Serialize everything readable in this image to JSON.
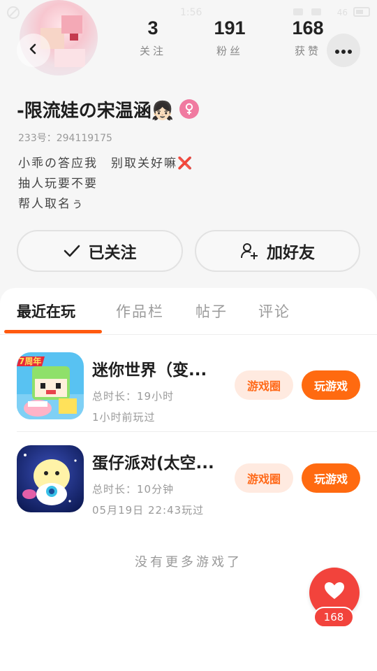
{
  "status_bar": {
    "time": "1:56",
    "battery_text": "46"
  },
  "profile": {
    "nickname": "-限流娃の宋温涵👧🏻",
    "uid": "233号：294119175",
    "bio_lines": [
      "小乖の答应我　别取关好嘛❌",
      "抽人玩要不要",
      "帮人取名ぅ"
    ]
  },
  "stats": [
    {
      "value": "3",
      "label": "关注"
    },
    {
      "value": "191",
      "label": "粉丝"
    },
    {
      "value": "168",
      "label": "获赞"
    }
  ],
  "actions": {
    "followed_label": "已关注",
    "add_friend_label": "加好友"
  },
  "tabs": [
    {
      "label": "最近在玩",
      "active": true
    },
    {
      "label": "作品栏",
      "active": false
    },
    {
      "label": "帖子",
      "active": false
    },
    {
      "label": "评论",
      "active": false
    }
  ],
  "games": [
    {
      "title": "迷你世界（变...",
      "duration": "总时长：19小时",
      "last_played": "1小时前玩过",
      "circle_label": "游戏圈",
      "play_label": "玩游戏",
      "icon": "mini-world-game-icon",
      "icon_text": "7周年"
    },
    {
      "title": "蛋仔派对(太空...",
      "duration": "总时长：10分钟",
      "last_played": "05月19日 22:43玩过",
      "circle_label": "游戏圈",
      "play_label": "玩游戏",
      "icon": "eggy-party-game-icon"
    }
  ],
  "no_more_text": "没有更多游戏了",
  "like": {
    "count": "168"
  },
  "colors": {
    "accent": "#ff6a10",
    "accent_soft": "#ffeae0",
    "tab_underline": "#ff5a0f",
    "like_red": "#f2433c",
    "gender_pink": "#f07aa0"
  },
  "icons": [
    "back-icon",
    "more-icon",
    "check-icon",
    "add-user-icon",
    "female-icon",
    "heart-icon"
  ]
}
